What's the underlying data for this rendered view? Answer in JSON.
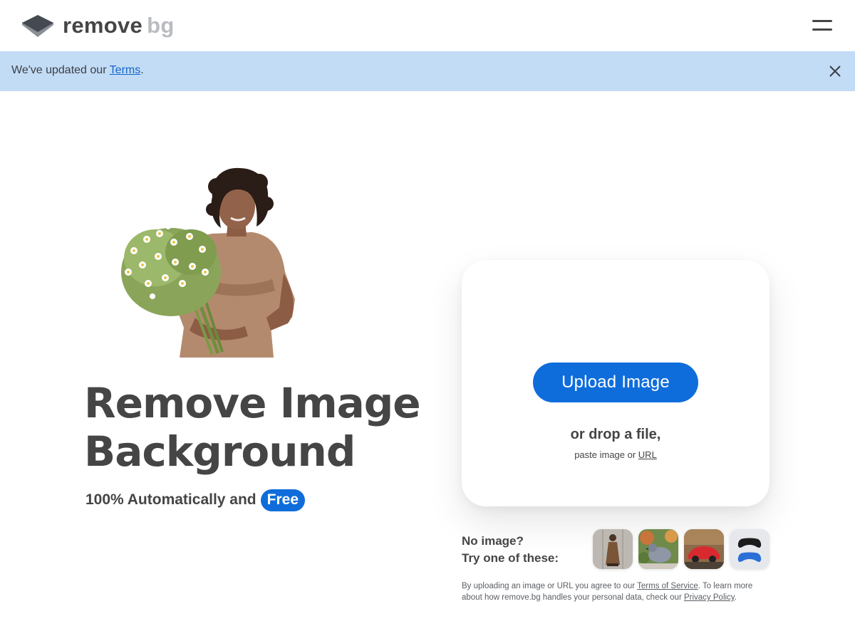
{
  "header": {
    "logo_word1": "remove",
    "logo_word2": "bg",
    "menu_icon": "hamburger-menu-icon"
  },
  "notice": {
    "prefix": "We've updated our ",
    "link": "Terms",
    "suffix": ".",
    "close_icon": "close-icon",
    "background": "#c3dcf6"
  },
  "hero": {
    "headline_line1": "Remove Image",
    "headline_line2": "Background",
    "tagline": "100% Automatically and",
    "badge": "Free"
  },
  "upload": {
    "button_label": "Upload Image",
    "drop_text": "or drop a file,",
    "paste_prefix": "paste image or ",
    "paste_link": "URL"
  },
  "samples": {
    "line1": "No image?",
    "line2": "Try one of these:",
    "items": [
      "woman-sample",
      "pigeon-sample",
      "car-sample",
      "controllers-sample"
    ]
  },
  "legal": {
    "part1": "By uploading an image or URL you agree to our ",
    "tos_link": "Terms of Service",
    "part2": ". To learn more about how remove.bg handles your personal data, check our ",
    "privacy_link": "Privacy Policy",
    "part3": "."
  },
  "colors": {
    "accent": "#0f6ddb",
    "text": "#454545",
    "logo_grey": "#b9bcc0"
  }
}
